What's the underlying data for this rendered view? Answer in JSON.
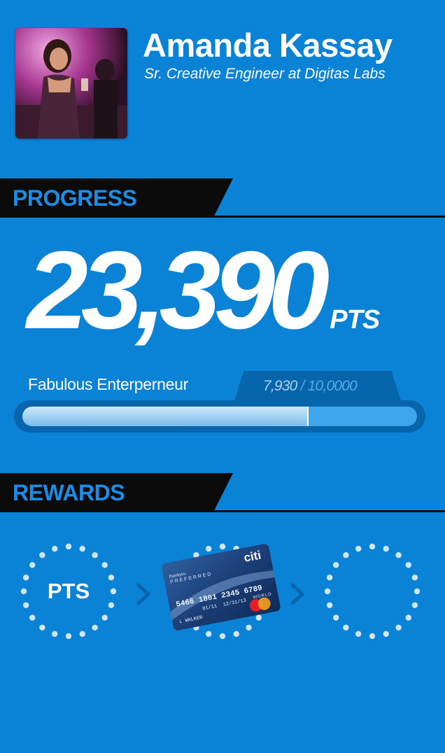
{
  "profile": {
    "name": "Amanda Kassay",
    "title": "Sr. Creative Engineer at Digitas Labs"
  },
  "progress": {
    "section_label": "PROGRESS",
    "points": "23,390",
    "points_unit": "PTS",
    "level_name": "Fabulous Enterperneur",
    "current_label": "7,930",
    "separator": " / ",
    "target_label": "10,0000",
    "fraction": 0.725
  },
  "rewards": {
    "section_label": "REWARDS",
    "items": [
      {
        "label": "PTS",
        "icon": "points-ring-icon"
      },
      {
        "label": "",
        "icon": "credit-card-icon"
      },
      {
        "label": "",
        "icon": "empty-ring-icon"
      }
    ],
    "card": {
      "brand": "citi",
      "program": "thankyou",
      "tier": "PREFERRED",
      "number": "5466 1801 2345 6789",
      "network": "WORLD",
      "member_since": "01/11",
      "expires": "12/31/13",
      "holder": "L WALKER"
    }
  },
  "colors": {
    "background": "#0a82d6",
    "bar_black": "#0b0b0b",
    "section_text": "#1a8ee6",
    "track": "#0765ab",
    "dots": "#cfe6f9"
  }
}
